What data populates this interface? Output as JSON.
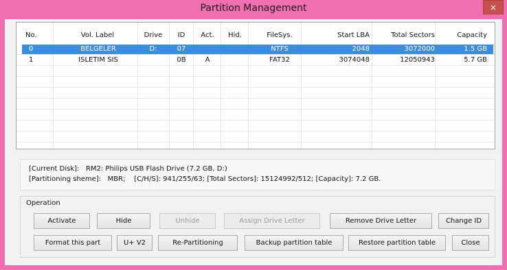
{
  "window": {
    "title": "Partition Management",
    "close_label": "×"
  },
  "table": {
    "columns": [
      "No.",
      "Vol. Label",
      "Drive",
      "ID",
      "Act.",
      "Hid.",
      "FileSys.",
      "Start LBA",
      "Total Sectors",
      "Capacity"
    ],
    "rows": [
      {
        "no": "0",
        "label": "BELGELER",
        "drive": "D:",
        "id": "07",
        "act": "",
        "hid": "",
        "fs": "NTFS",
        "start": "2048",
        "total": "3072000",
        "cap": "1.5 GB",
        "selected": true
      },
      {
        "no": "1",
        "label": "ISLETIM SIS",
        "drive": "",
        "id": "0B",
        "act": "A",
        "hid": "",
        "fs": "FAT32",
        "start": "3074048",
        "total": "12050943",
        "cap": "5.7 GB",
        "selected": false
      }
    ]
  },
  "info": {
    "current_disk_key": "[Current Disk]:",
    "current_disk_val": "RM2: Philips USB Flash Drive (7.2 GB, D:)",
    "partitioning_key": "[Partitioning sheme]:",
    "partitioning_val": "MBR;",
    "chs": "[C/H/S]: 941/255/63;",
    "total_sectors": "[Total Sectors]: 15124992/512;",
    "capacity": "[Capacity]: 7.2 GB."
  },
  "operation": {
    "label": "Operation",
    "activate": "Activate",
    "hide": "Hide",
    "unhide": "Unhide",
    "assign": "Assign Drive Letter",
    "remove": "Remove Drive Letter",
    "change_id": "Change ID",
    "format": "Format this part",
    "uv2": "U+ V2",
    "repartition": "Re-Partitioning",
    "backup": "Backup partition table",
    "restore": "Restore partition table",
    "close": "Close"
  },
  "colors": {
    "accent": "#f06fb0",
    "selection": "#3a8de0",
    "close": "#c7504c"
  }
}
